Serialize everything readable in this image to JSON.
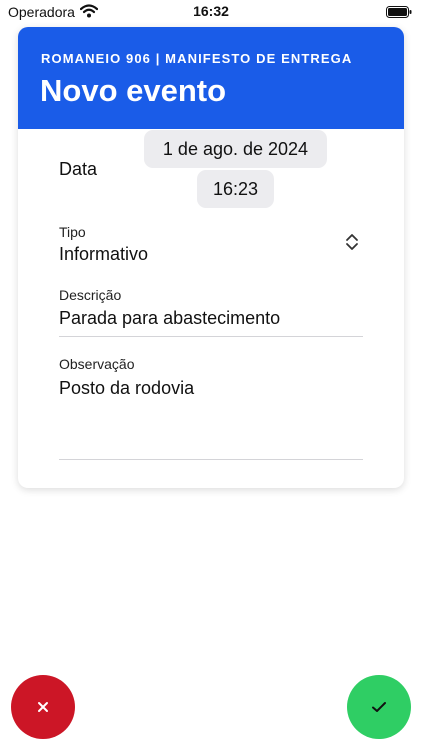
{
  "status_bar": {
    "carrier": "Operadora",
    "time": "16:32"
  },
  "header": {
    "subtitle": "ROMANEIO 906 | MANIFESTO DE ENTREGA",
    "title": "Novo evento"
  },
  "form": {
    "date_label": "Data",
    "date_value": "1 de ago. de 2024",
    "time_value": "16:23",
    "type_label": "Tipo",
    "type_value": "Informativo",
    "description_label": "Descrição",
    "description_value": "Parada para abastecimento",
    "observation_label": "Observação",
    "observation_value": "Posto da rodovia"
  },
  "actions": {
    "cancel_icon": "close-icon",
    "confirm_icon": "check-icon"
  },
  "colors": {
    "header_bg": "#1a5ce8",
    "cancel_bg": "#cc1626",
    "confirm_bg": "#2fce64"
  }
}
